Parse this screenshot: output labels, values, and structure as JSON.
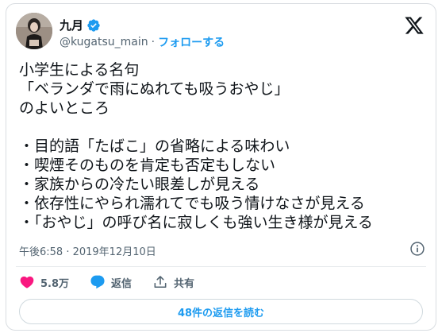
{
  "author": {
    "name": "九月",
    "handle": "@kugatsu_main",
    "separator": "·",
    "follow_label": "フォローする"
  },
  "tweet": {
    "lines": [
      "小学生による名句",
      "「ベランダで雨にぬれても吸うおやじ」",
      "のよいところ",
      "",
      "・目的語「たばこ」の省略による味わい",
      "・喫煙そのものを肯定も否定もしない",
      "・家族からの冷たい眼差しが見える",
      "・依存性にやられ濡れてでも吸う情けなさが見える",
      "・「おやじ」の呼び名に寂しくも強い生き様が見える"
    ],
    "timestamp": "午後6:58 · 2019年12月10日"
  },
  "actions": {
    "like_count": "5.8万",
    "reply_label": "返信",
    "share_label": "共有"
  },
  "read_replies_label": "48件の返信を読む",
  "colors": {
    "accent": "#1d9bf0",
    "like": "#f91880",
    "text": "#0f1419",
    "muted": "#536471"
  }
}
